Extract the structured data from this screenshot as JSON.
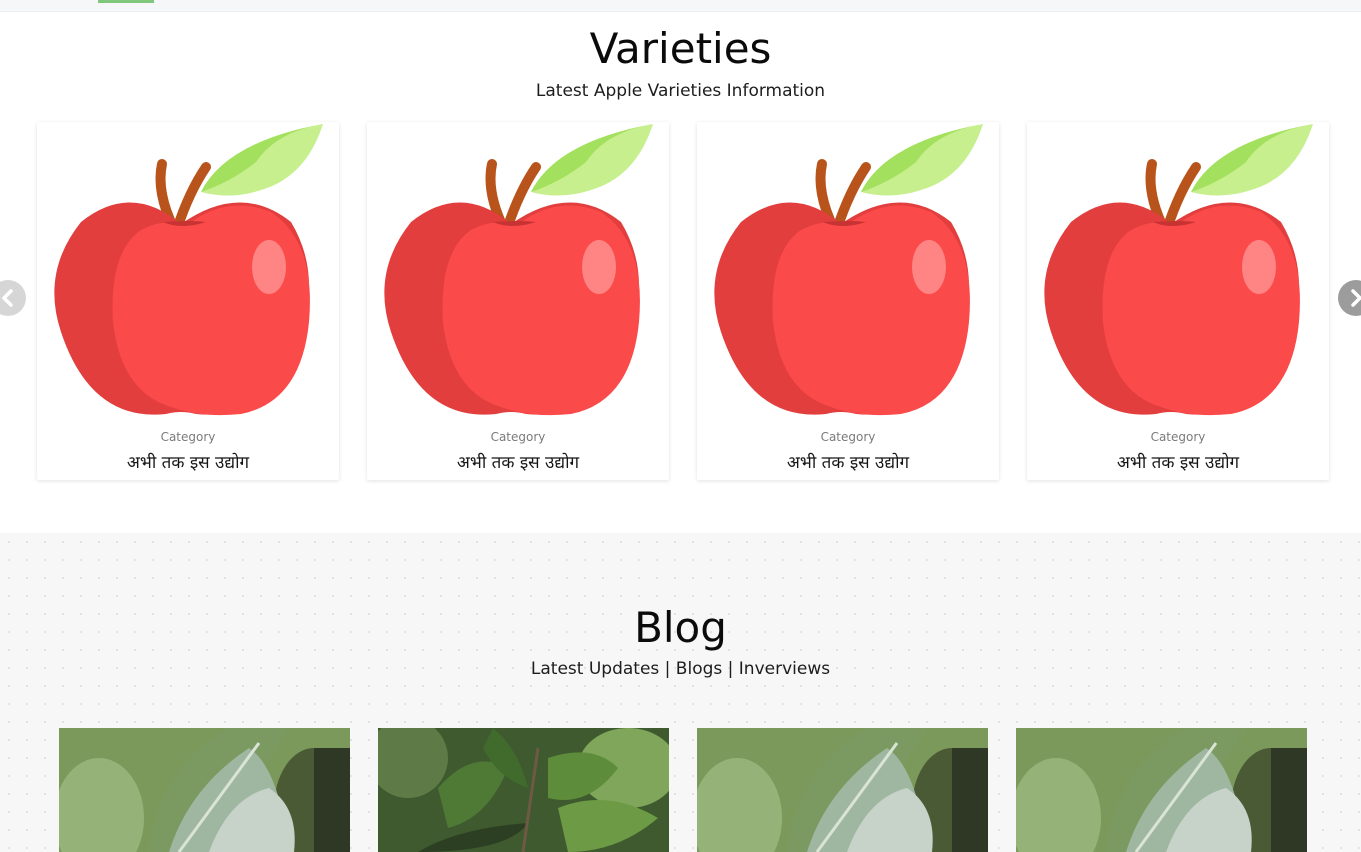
{
  "varieties": {
    "title": "Varieties",
    "subtitle": "Latest Apple Varieties Information",
    "cards": [
      {
        "category": "Category",
        "title": "अभी तक इस उद्योग"
      },
      {
        "category": "Category",
        "title": "अभी तक इस उद्योग"
      },
      {
        "category": "Category",
        "title": "अभी तक इस उद्योग"
      },
      {
        "category": "Category",
        "title": "अभी तक इस उद्योग"
      }
    ],
    "prev_icon": "chevron-left-icon",
    "next_icon": "chevron-right-icon"
  },
  "blog": {
    "title": "Blog",
    "subtitle": "Latest Updates | Blogs | Inverviews"
  },
  "colors": {
    "accent_green": "#7fc77a",
    "apple_red": "#fa4a4a",
    "apple_shadow": "#e03e3e",
    "leaf_green": "#a6e36a",
    "stem_brown": "#b8541b"
  }
}
